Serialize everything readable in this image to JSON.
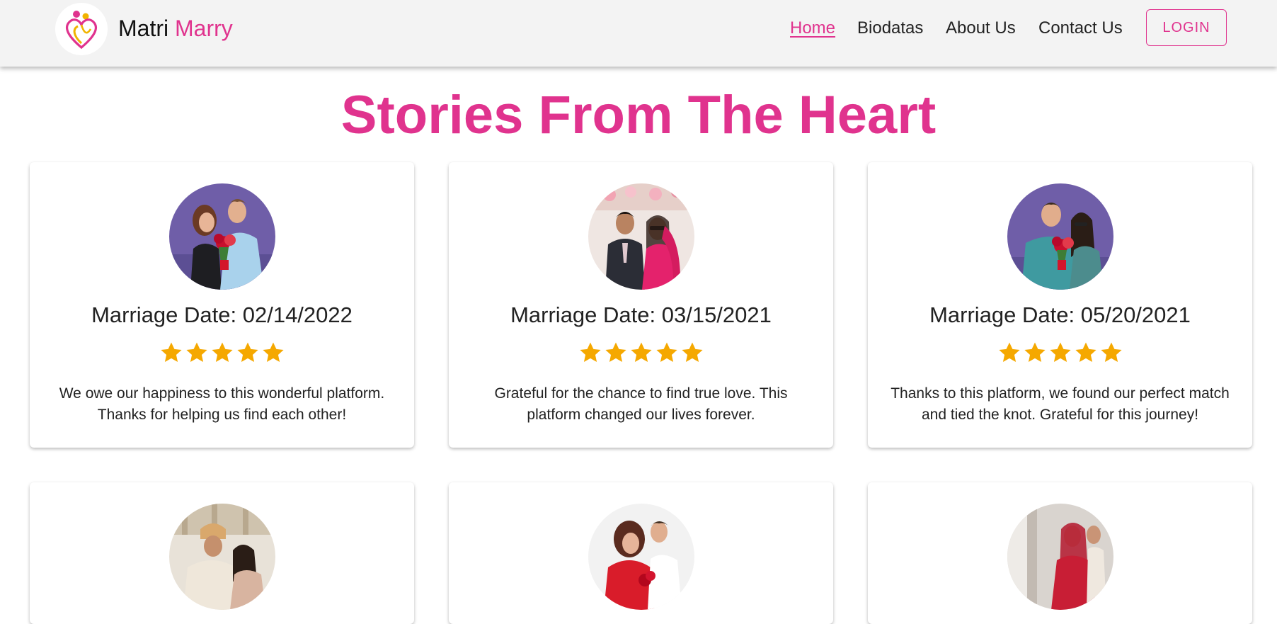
{
  "brand": {
    "first": "Matri",
    "second": "Marry"
  },
  "nav": {
    "home": "Home",
    "biodatas": "Biodatas",
    "about": "About Us",
    "contact": "Contact Us",
    "login": "LOGIN"
  },
  "page": {
    "title": "Stories From The Heart"
  },
  "colors": {
    "accent": "#e0338e",
    "star": "#f5a800",
    "header_bg": "#f3f3f3"
  },
  "stories": [
    {
      "date_label": "Marriage Date: 02/14/2022",
      "rating": 5,
      "text": "We owe our happiness to this wonderful platform. Thanks for helping us find each other!"
    },
    {
      "date_label": "Marriage Date: 03/15/2021",
      "rating": 5,
      "text": "Grateful for the chance to find true love. This platform changed our lives forever."
    },
    {
      "date_label": "Marriage Date: 05/20/2021",
      "rating": 5,
      "text": "Thanks to this platform, we found our perfect match and tied the knot. Grateful for this journey!"
    }
  ],
  "icons": {
    "logo": "heart-logo-icon",
    "star": "star-icon"
  }
}
